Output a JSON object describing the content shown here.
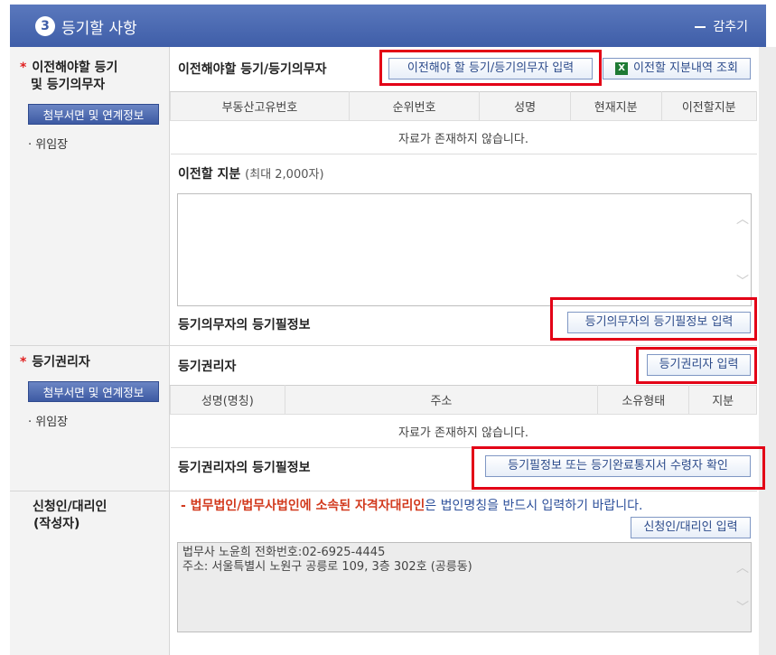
{
  "header": {
    "step": "3",
    "title": "등기할 사항",
    "collapse_label": "감추기"
  },
  "sections": {
    "transfer": {
      "required_mark": "*",
      "title_line1": "이전해야할 등기",
      "title_line2": "및 등기의무자",
      "attach_label": "첨부서면 및 연계정보",
      "proxy_label": "위임장",
      "table_label": "이전해야할 등기/등기의무자",
      "input_button": "이전해야 할 등기/등기의무자 입력",
      "view_button": "이전할 지분내역 조회",
      "columns": [
        "부동산고유번호",
        "순위번호",
        "성명",
        "현재지분",
        "이전할지분"
      ],
      "empty_text": "자료가 존재하지 않습니다.",
      "share_label": "이전할 지분",
      "share_note": "(최대 2,000자)",
      "share_value": "",
      "info_label": "등기의무자의 등기필정보",
      "info_button": "등기의무자의 등기필정보 입력"
    },
    "holder": {
      "required_mark": "*",
      "title": "등기권리자",
      "attach_label": "첨부서면 및 연계정보",
      "proxy_label": "위임장",
      "table_label": "등기권리자",
      "input_button": "등기권리자 입력",
      "columns": [
        "성명(명칭)",
        "주소",
        "소유형태",
        "지분"
      ],
      "empty_text": "자료가 존재하지 않습니다.",
      "info_label": "등기권리자의 등기필정보",
      "info_button": "등기필정보 또는 등기완료통지서 수령자 확인"
    },
    "applicant": {
      "title_line1": "신청인/대리인",
      "title_line2": "(작성자)",
      "notice_prefix": "- 법무법인/법무사법인에 소속된 자격자대리인",
      "notice_suffix": "은 법인명칭을 반드시 입력하기 바랍니다.",
      "input_button": "신청인/대리인 입력",
      "text_value": "법무사 노윤희 전화번호:02-6925-4445\n주소: 서울특별시 노원구 공릉로 109, 3층 302호 (공릉동)"
    }
  },
  "colors": {
    "header": "#4a67ae",
    "highlight": "#e30016",
    "notice_red": "#d23a1e",
    "notice_blue": "#2c4f9a"
  }
}
